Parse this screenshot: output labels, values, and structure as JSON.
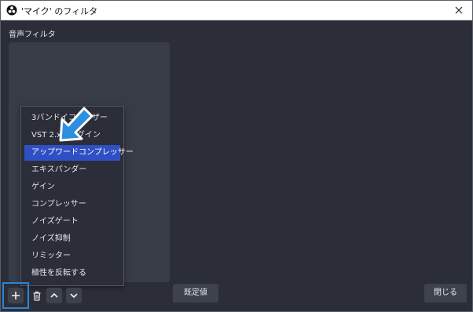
{
  "window": {
    "title": "'マイク' のフィルタ"
  },
  "section": {
    "label": "音声フィルタ"
  },
  "menu": {
    "items": [
      "3バンドイコライザー",
      "VST 2.xプラグイン",
      "アップワードコンプレッサー",
      "エキスパンダー",
      "ゲイン",
      "コンプレッサー",
      "ノイズゲート",
      "ノイズ抑制",
      "リミッター",
      "極性を反転する"
    ],
    "selected_index": 2
  },
  "buttons": {
    "defaults": "既定値",
    "close": "閉じる"
  },
  "icons": {
    "app": "obs-icon",
    "close": "close-icon",
    "add": "plus-icon",
    "remove": "trash-icon",
    "up": "chevron-up-icon",
    "down": "chevron-down-icon",
    "annotation": "arrow-pointer-icon"
  },
  "colors": {
    "background": "#2b2e38",
    "selection": "#2f4fc5",
    "highlight": "#2a84d8",
    "annotation_arrow": "#2e8fe0"
  }
}
